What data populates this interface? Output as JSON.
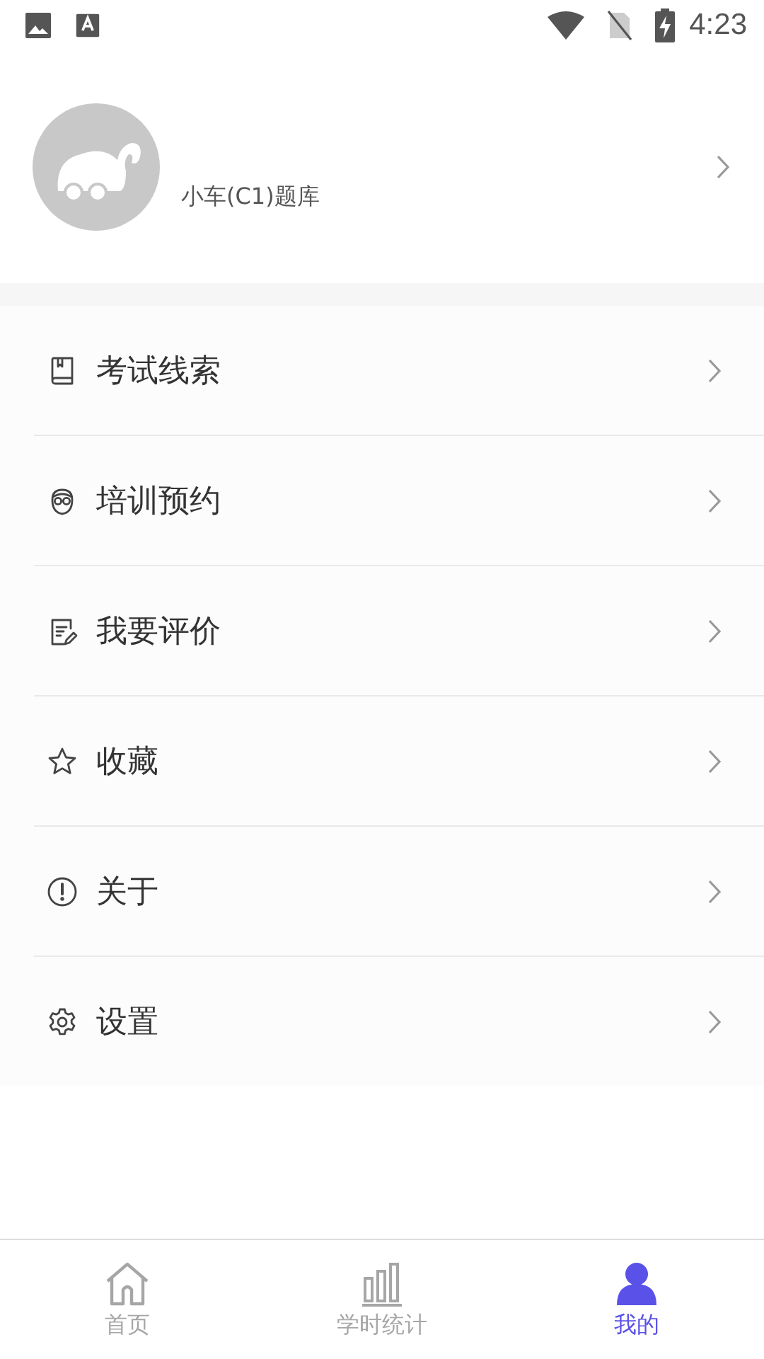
{
  "status_bar": {
    "time": "4:23"
  },
  "profile": {
    "subtitle": "小车(C1)题库"
  },
  "menu": [
    {
      "label": "考试线索",
      "kind": "book"
    },
    {
      "label": "培训预约",
      "kind": "glasses"
    },
    {
      "label": "我要评价",
      "kind": "note"
    },
    {
      "label": "收藏",
      "kind": "star"
    },
    {
      "label": "关于",
      "kind": "info"
    },
    {
      "label": "设置",
      "kind": "gear"
    }
  ],
  "bottom_nav": [
    {
      "label": "首页",
      "kind": "home",
      "selected": false
    },
    {
      "label": "学时统计",
      "kind": "stats",
      "selected": false
    },
    {
      "label": "我的",
      "kind": "user",
      "selected": true
    }
  ]
}
